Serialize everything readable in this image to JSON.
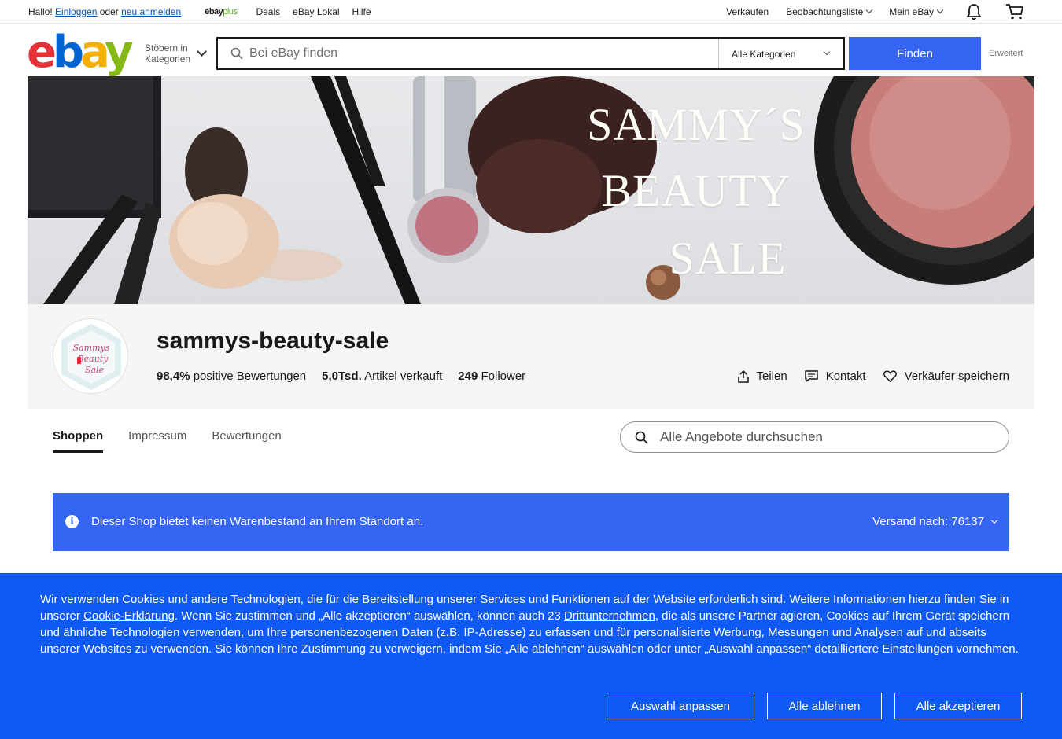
{
  "topbar": {
    "greeting": "Hallo!",
    "login": "Einloggen",
    "or": "oder",
    "register": "neu anmelden",
    "ebayplus_brand": "ebay",
    "ebayplus_suffix": "plus",
    "links": [
      "Deals",
      "eBay Lokal",
      "Hilfe"
    ],
    "sell": "Verkaufen",
    "watchlist": "Beobachtungsliste",
    "my_ebay": "Mein eBay"
  },
  "header": {
    "logo": [
      "e",
      "b",
      "a",
      "y"
    ],
    "browse_line1": "Stöbern in",
    "browse_line2": "Kategorien",
    "search_placeholder": "Bei eBay finden",
    "category": "Alle Kategorien",
    "find_label": "Finden",
    "advanced": "Erweitert"
  },
  "banner": {
    "line1": "SAMMY´S",
    "line2": "BEAUTY",
    "line3": "SALE"
  },
  "seller": {
    "avatar_text": "Sammys Beauty Sale",
    "name": "sammys-beauty-sale",
    "positive_value": "98,4%",
    "positive_label": "positive Bewertungen",
    "sold_value": "5,0Tsd.",
    "sold_label": "Artikel verkauft",
    "followers_value": "249",
    "followers_label": "Follower",
    "share": "Teilen",
    "contact": "Kontakt",
    "save": "Verkäufer speichern"
  },
  "tabs": [
    "Shoppen",
    "Impressum",
    "Bewertungen"
  ],
  "store_search_placeholder": "Alle Angebote durchsuchen",
  "info": {
    "icon": "i",
    "message": "Dieser Shop bietet keinen Warenbestand an Ihrem Standort an.",
    "ship_label": "Versand nach:",
    "ship_zip": "76137"
  },
  "cookie": {
    "text_a": "Wir verwenden Cookies und andere Technologien, die für die Bereitstellung unserer Services und Funktionen auf der Website erforderlich sind. Weitere Informationen hierzu finden Sie in unserer ",
    "link_a": "Cookie-Erklärung",
    "text_b": ". Wenn Sie zustimmen und „Alle akzeptieren“ auswählen, können auch 23 ",
    "link_b": "Drittunternehmen",
    "text_c": ", die als unsere Partner agieren, Cookies auf Ihrem Gerät speichern und ähnliche Technologien verwenden, um Ihre personenbezogenen Daten (z.B. IP-Adresse) zu erfassen und für personalisierte Werbung, Messungen und Analysen auf und abseits unserer Websites zu verwenden. Sie können Ihre Zustimmung zu verweigern, indem Sie „Alle ablehnen“ auswählen oder unter „Auswahl anpassen“ detailliertere Einstellungen vornehmen.",
    "customize": "Auswahl anpassen",
    "reject": "Alle ablehnen",
    "accept": "Alle akzeptieren"
  }
}
